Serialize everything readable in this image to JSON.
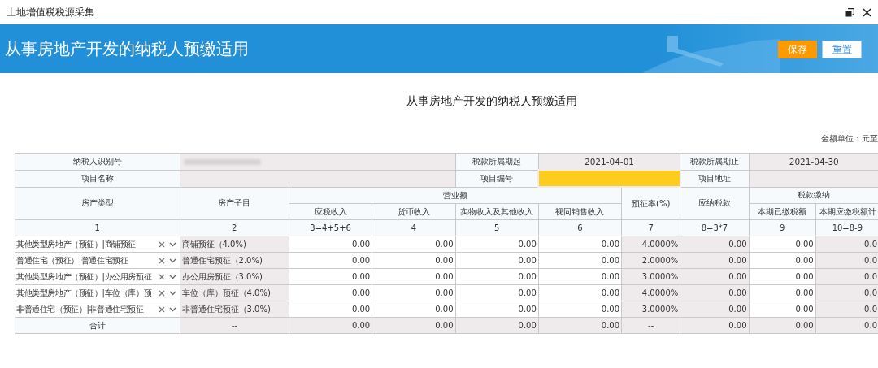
{
  "window": {
    "title": "土地增值税税源采集"
  },
  "banner": {
    "title": "从事房地产开发的纳税人预缴适用",
    "buttons": [
      {
        "label": "保存",
        "kind": "primary"
      },
      {
        "label": "重置",
        "kind": "secondary"
      }
    ]
  },
  "form": {
    "title": "从事房地产开发的纳税人预缴适用",
    "unit": "金额单位：元至",
    "info": [
      [
        {
          "label": "纳税人识别号"
        },
        {
          "redacted": true
        },
        {
          "label": "税款所属期起"
        },
        {
          "value": "2021-04-01"
        },
        {
          "label": "税款所属期止"
        },
        {
          "value": "2021-04-30"
        }
      ],
      [
        {
          "label": "项目名称"
        },
        {
          "highlight": false
        },
        {
          "label": "项目编号"
        },
        {
          "highlight": true
        },
        {
          "label": "项目地址"
        },
        {
          "highlight": false
        }
      ]
    ],
    "header": {
      "col1": "房产类型",
      "col2": "房产子目",
      "group1": "营业额",
      "sub1": [
        "应税收入",
        "货币收入",
        "实物收入及其他收入",
        "视同销售收入"
      ],
      "col7": "预征率(%)",
      "col8": "应纳税款",
      "group2": "税款缴纳",
      "sub2": [
        "本期已缴税额",
        "本期应缴税额计"
      ]
    },
    "numbers": [
      "1",
      "2",
      "3=4+5+6",
      "4",
      "5",
      "6",
      "7",
      "8=3*7",
      "9",
      "10=8-9"
    ],
    "rows": [
      {
        "kind": "entry",
        "cells": [
          "其他类型房地产（预征）|商铺预征",
          "商铺预征（4.0%)",
          "0.00",
          "0.00",
          "0.00",
          "0.00",
          "4.0000%",
          "0.00",
          "0.00",
          "0.0"
        ]
      },
      {
        "kind": "entry",
        "cells": [
          "普通住宅（预征）|普通住宅预征",
          "普通住宅预征（2.0%)",
          "0.00",
          "0.00",
          "0.00",
          "0.00",
          "2.0000%",
          "0.00",
          "0.00",
          "0.0"
        ]
      },
      {
        "kind": "entry",
        "cells": [
          "其他类型房地产（预征）|办公用房预征",
          "办公用房预征（3.0%)",
          "0.00",
          "0.00",
          "0.00",
          "0.00",
          "3.0000%",
          "0.00",
          "0.00",
          "0.0"
        ]
      },
      {
        "kind": "entry",
        "cells": [
          "其他类型房地产（预征）|车位（库）预",
          "车位（库）预征（4.0%)",
          "0.00",
          "0.00",
          "0.00",
          "0.00",
          "4.0000%",
          "0.00",
          "0.00",
          "0.0"
        ]
      },
      {
        "kind": "entry",
        "cells": [
          "非普通住宅（预征）|非普通住宅预征",
          "非普通住宅预征（3.0%)",
          "0.00",
          "0.00",
          "0.00",
          "0.00",
          "3.0000%",
          "0.00",
          "0.00",
          "0.0"
        ]
      },
      {
        "kind": "total",
        "cells": [
          "合计",
          "--",
          "0.00",
          "0.00",
          "0.00",
          "0.00",
          "--",
          "0.00",
          "0.00",
          "0.0"
        ]
      }
    ]
  }
}
